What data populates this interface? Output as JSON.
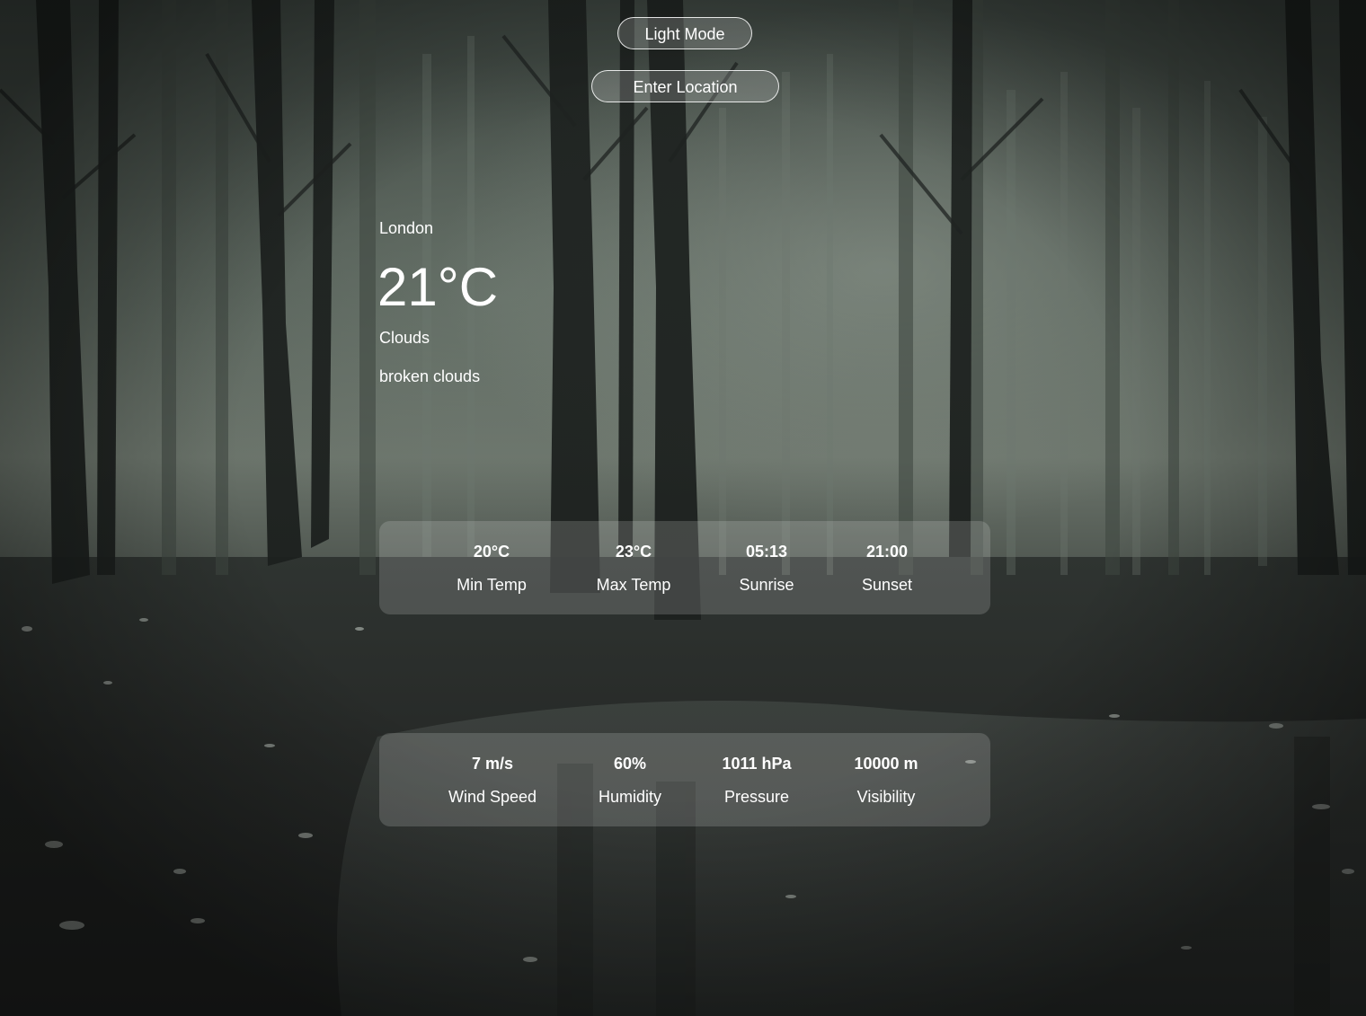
{
  "controls": {
    "mode_toggle_label": "Light Mode",
    "location_button_label": "Enter Location"
  },
  "current": {
    "city": "London",
    "temperature": "21°C",
    "condition": "Clouds",
    "description": "broken clouds"
  },
  "summary_stats": [
    {
      "value": "20°C",
      "label": "Min Temp"
    },
    {
      "value": "23°C",
      "label": "Max Temp"
    },
    {
      "value": "05:13",
      "label": "Sunrise"
    },
    {
      "value": "21:00",
      "label": "Sunset"
    }
  ],
  "detail_stats": [
    {
      "value": "7 m/s",
      "label": "Wind Speed"
    },
    {
      "value": "60%",
      "label": "Humidity"
    },
    {
      "value": "1011 hPa",
      "label": "Pressure"
    },
    {
      "value": "10000 m",
      "label": "Visibility"
    }
  ],
  "background": {
    "scene": "foggy-forest-image"
  }
}
